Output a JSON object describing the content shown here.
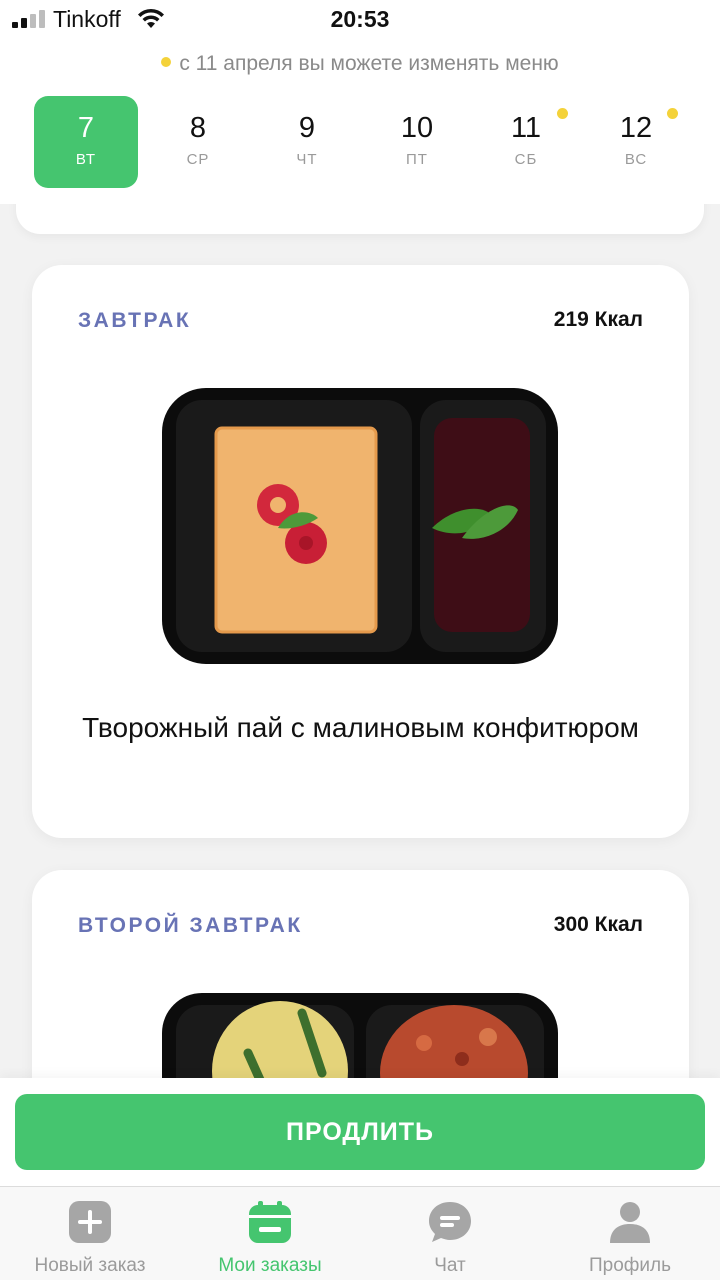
{
  "status_bar": {
    "carrier": "Tinkoff",
    "time": "20:53"
  },
  "notice": "с 11 апреля вы можете изменять меню",
  "days": [
    {
      "num": "7",
      "weekday": "ВТ",
      "active": true,
      "dot": false
    },
    {
      "num": "8",
      "weekday": "СР",
      "active": false,
      "dot": false
    },
    {
      "num": "9",
      "weekday": "ЧТ",
      "active": false,
      "dot": false
    },
    {
      "num": "10",
      "weekday": "ПТ",
      "active": false,
      "dot": false
    },
    {
      "num": "11",
      "weekday": "СБ",
      "active": false,
      "dot": true
    },
    {
      "num": "12",
      "weekday": "ВС",
      "active": false,
      "dot": true
    }
  ],
  "meals": [
    {
      "type": "ЗАВТРАК",
      "kcal": "219 Ккал",
      "name": "Творожный пай с малиновым конфитюром"
    },
    {
      "type": "ВТОРОЙ ЗАВТРАК",
      "kcal": "300 Ккал"
    }
  ],
  "action": {
    "extend_label": "ПРОДЛИТЬ"
  },
  "tabs": [
    {
      "label": "Новый заказ",
      "icon": "plus-square-icon"
    },
    {
      "label": "Мои заказы",
      "icon": "calendar-icon",
      "active": true
    },
    {
      "label": "Чат",
      "icon": "chat-bubble-icon"
    },
    {
      "label": "Профиль",
      "icon": "person-icon"
    }
  ],
  "colors": {
    "accent": "#45c56f",
    "meal_type": "#6873b5",
    "dot": "#f4d23a",
    "inactive_tab": "#9b9b9b"
  }
}
